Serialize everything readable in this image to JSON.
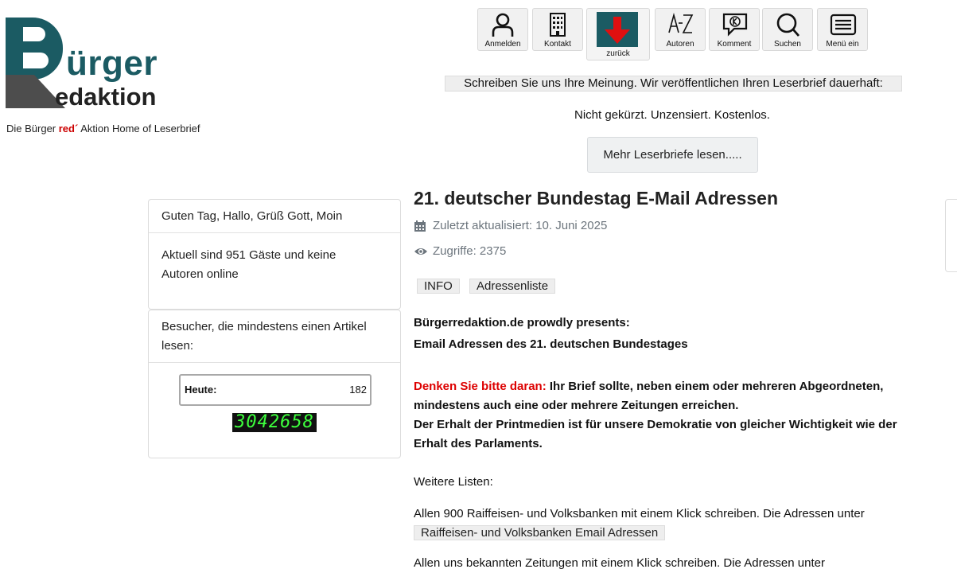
{
  "logo": {
    "text_main": "ürger",
    "text_sub": "edaktion",
    "alt": "Bürger Redaktion"
  },
  "tagline": {
    "prefix": "Die Bürger ",
    "red": "red",
    "mark": "´",
    "suffix": " Aktion  Home of Leserbrief"
  },
  "toolbar": {
    "items": [
      {
        "label": "Anmelden",
        "icon": "user-icon"
      },
      {
        "label": "Kontakt",
        "icon": "building-icon"
      },
      {
        "label": "zurück",
        "icon": "arrow-down-icon"
      },
      {
        "label": "Autoren",
        "icon": "a-z-icon"
      },
      {
        "label": "Komment",
        "icon": "comment-icon"
      },
      {
        "label": "Suchen",
        "icon": "search-icon"
      },
      {
        "label": "Menü ein",
        "icon": "menu-icon"
      }
    ]
  },
  "notice": {
    "banner": "Schreiben Sie uns Ihre Meinung. Wir veröffentlichen Ihren Leserbrief dauerhaft:",
    "sub": "Nicht gekürzt. Unzensiert. Kostenlos.",
    "more_button": "Mehr Leserbriefe lesen....."
  },
  "sidebar": {
    "greeting": "Guten Tag, Hallo, Grüß Gott, Moin",
    "online_line1": "Aktuell sind 951 Gäste und keine",
    "online_line2": "Autoren online",
    "visitors_line1": "Besucher, die mindestens einen Artikel",
    "visitors_line2": "lesen:",
    "today_label": "Heute:",
    "today_value": "182",
    "total_counter": "3042658"
  },
  "article": {
    "title": "21. deutscher Bundestag E-Mail Adressen",
    "updated": "Zuletzt aktualisiert: 10. Juni 2025",
    "hits": "Zugriffe: 2375",
    "tags": [
      "INFO",
      "Adressenliste"
    ],
    "intro_line1": "Bürgerredaktion.de prowdly presents:",
    "intro_line2": "Email Adressen des 21. deutschen Bundestages",
    "reminder_red": "Denken Sie bitte daran:",
    "reminder_text1": " Ihr Brief sollte, neben einem oder mehreren Abgeordneten,",
    "reminder_text2": "mindestens auch eine oder mehrere Zeitungen erreichen.",
    "reminder_text3": "Der Erhalt der Printmedien ist für unsere Demokratie von gleicher Wichtigkeit wie der",
    "reminder_text4": "Erhalt des Parlaments.",
    "more_lists": "Weitere Listen:",
    "banks_text": "Allen 900 Raiffeisen- und Volksbanken mit einem Klick schreiben. Die Adressen unter",
    "banks_link": "Raiffeisen- und Volksbanken Email Adressen",
    "papers_text": "Allen uns bekannten Zeitungen mit einem Klick schreiben. Die Adressen unter"
  },
  "colors": {
    "brand_teal": "#1b5b63",
    "accent_red": "#dd0000",
    "counter_green": "#3dff3d"
  }
}
